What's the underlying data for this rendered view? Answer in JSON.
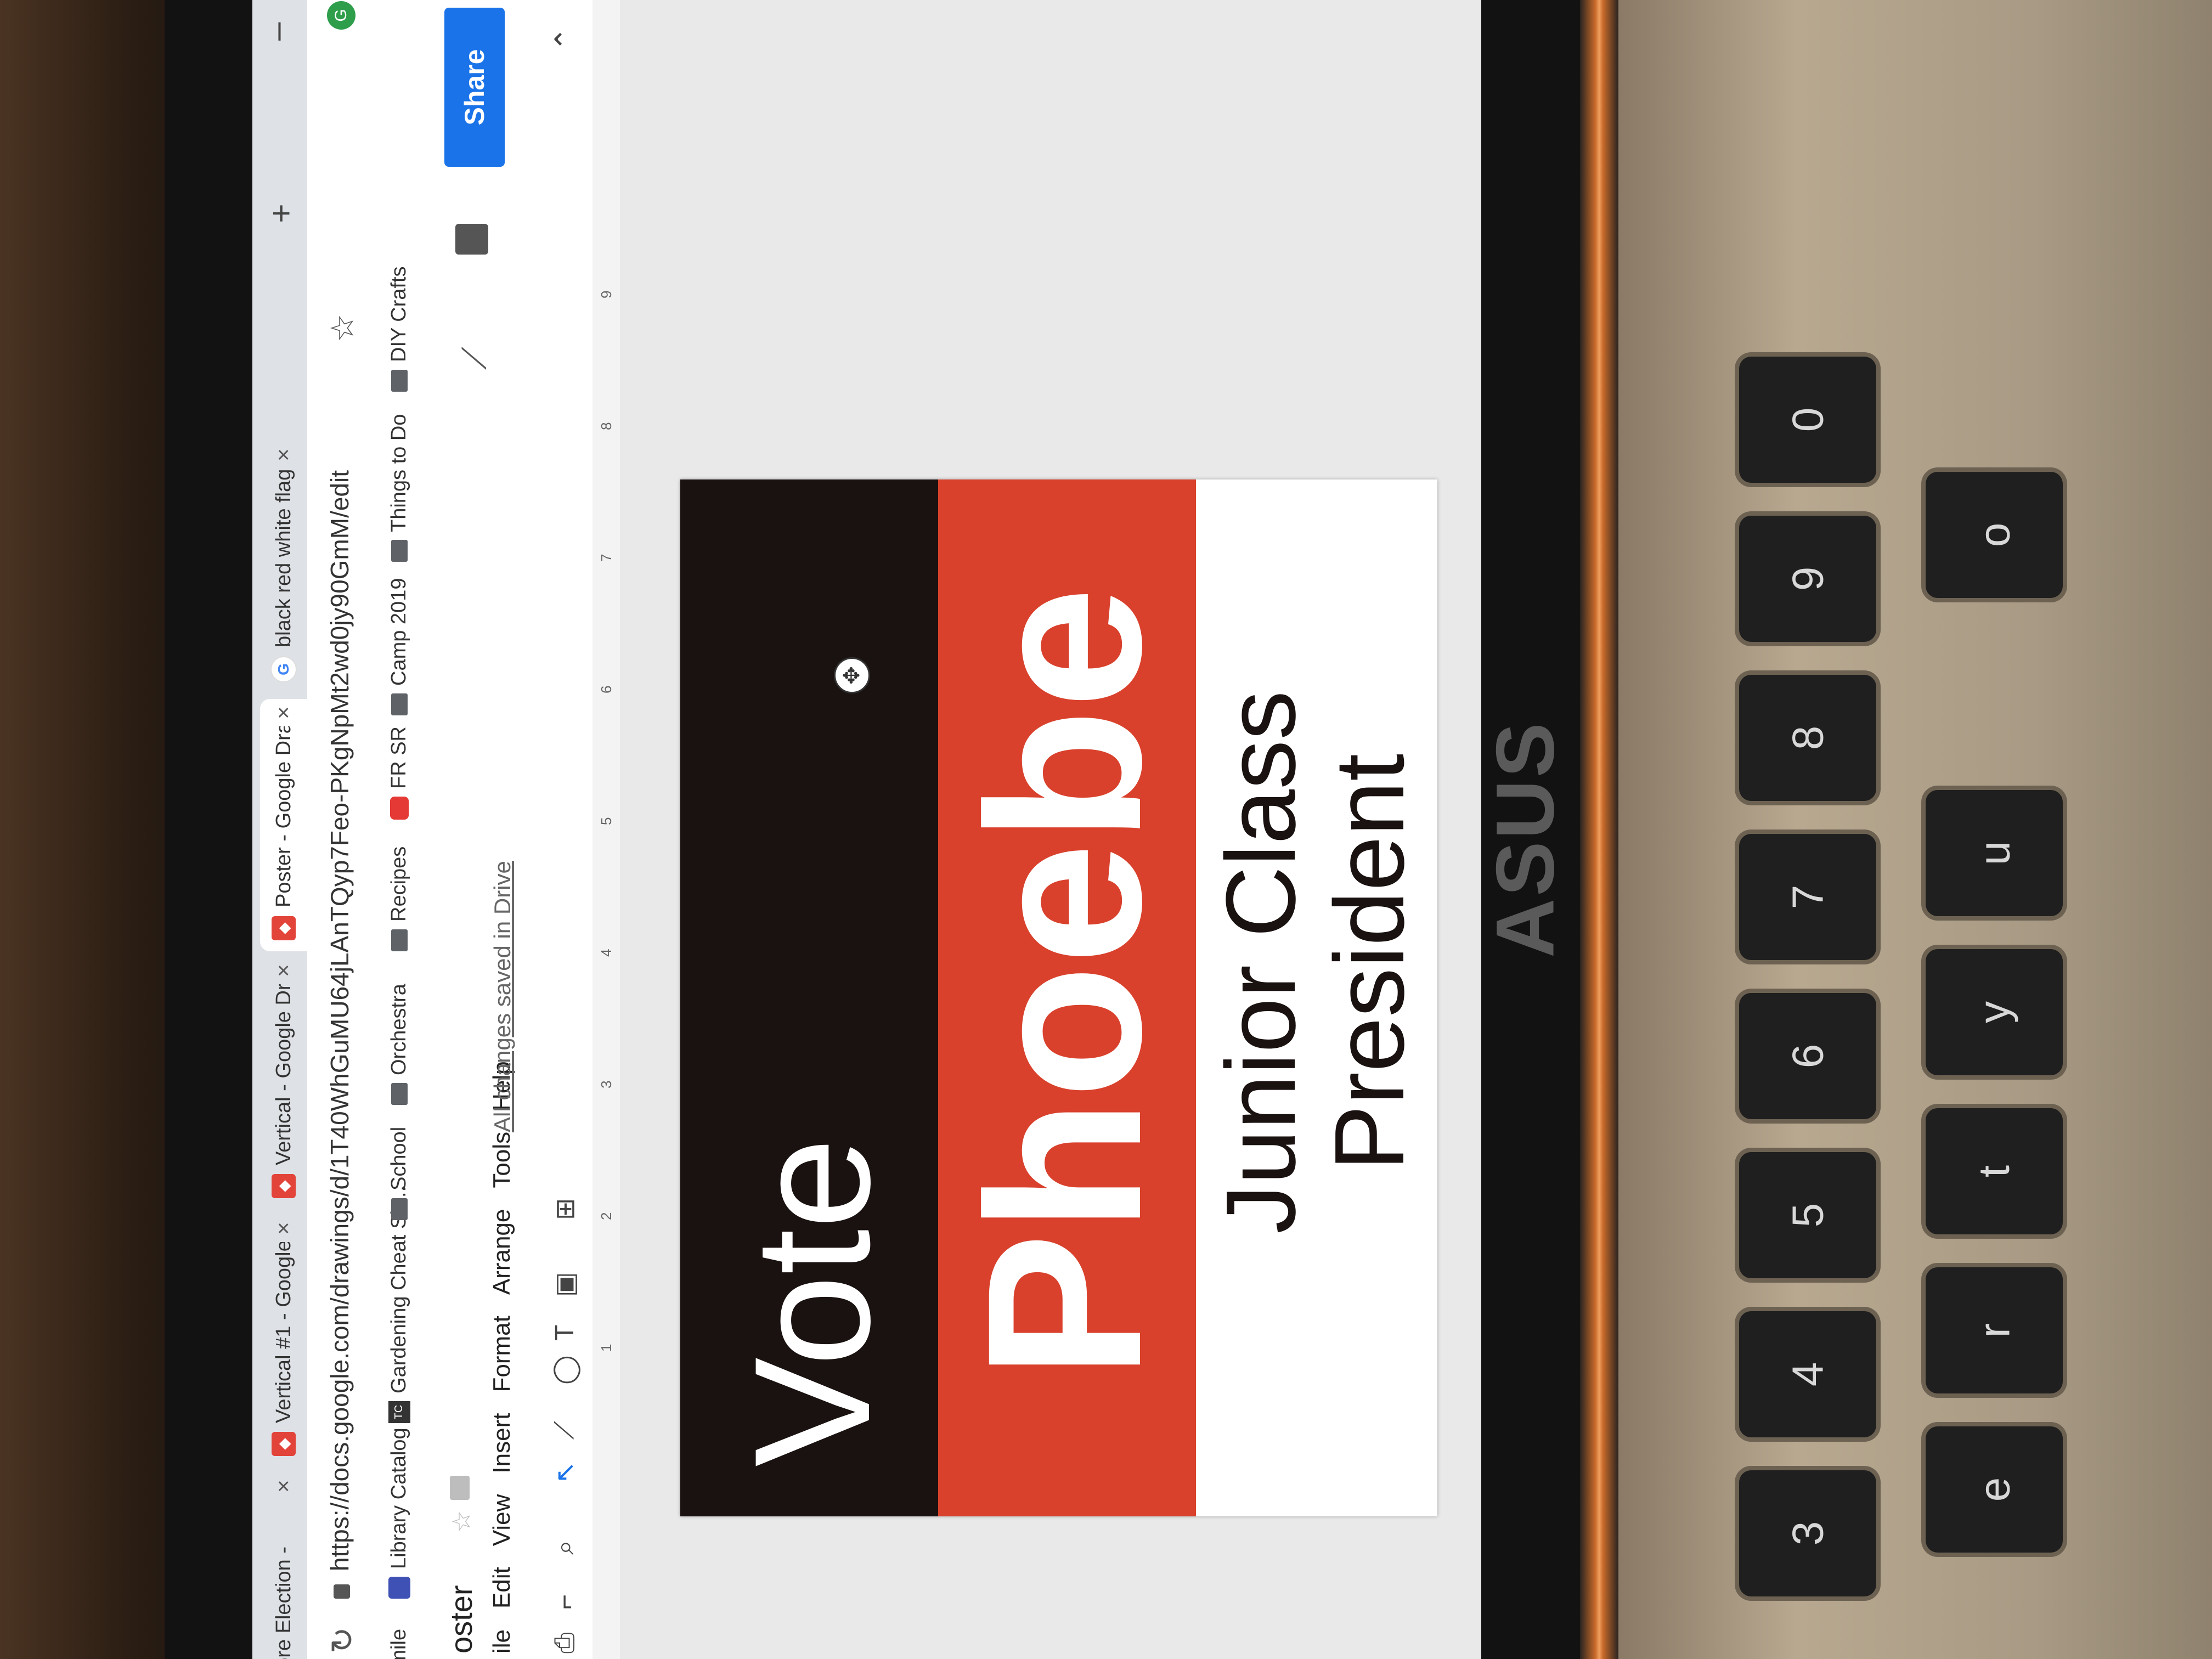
{
  "browser": {
    "tabs": [
      {
        "title": "nore Election -",
        "icon": "google-drawings-icon"
      },
      {
        "title": "Vertical #1 - Google D",
        "icon": "google-drawings-icon"
      },
      {
        "title": "Vertical - Google Draw",
        "icon": "google-drawings-icon"
      },
      {
        "title": "Poster - Google Drawi",
        "icon": "google-drawings-icon"
      },
      {
        "title": "black red white flag - G",
        "icon": "google-search-icon"
      }
    ],
    "close_glyph": "×",
    "new_tab_glyph": "+",
    "minimize_glyph": "–",
    "url": "https://docs.google.com/drawings/d/1T40WhGuMU64jLAnTQyp7Feo-PKgNpMt2wd0jy90GmM/edit",
    "bookmarks": [
      {
        "label": "Smile",
        "icon": "smile-icon"
      },
      {
        "label": "Library Catalog",
        "icon": "library-icon"
      },
      {
        "label": "Gardening Cheat Sh...",
        "icon": "tc-icon"
      },
      {
        "label": "School",
        "icon": "folder-icon"
      },
      {
        "label": "Orchestra",
        "icon": "folder-icon"
      },
      {
        "label": "Recipes",
        "icon": "folder-icon"
      },
      {
        "label": "FR SR",
        "icon": "youtube-icon"
      },
      {
        "label": "Camp 2019",
        "icon": "folder-icon"
      },
      {
        "label": "Things to Do",
        "icon": "folder-icon"
      },
      {
        "label": "DIY Crafts",
        "icon": "folder-icon"
      }
    ]
  },
  "app": {
    "doc_title": "oster",
    "menu": [
      "ile",
      "Edit",
      "View",
      "Insert",
      "Format",
      "Arrange",
      "Tools",
      "Help"
    ],
    "saved_status": "All changes saved in Drive",
    "share_label": "Share",
    "ruler_ticks": [
      "1",
      "2",
      "3",
      "4",
      "5",
      "6",
      "7",
      "8",
      "9"
    ]
  },
  "poster": {
    "line1": "Vote",
    "line2": "Phoebe",
    "line3": "Junior Class",
    "line4": "President",
    "colors": {
      "black_band": "#1a1210",
      "red_band": "#d9412c",
      "text_light": "#ffffff"
    }
  },
  "device": {
    "brand": "ASUS",
    "keys": [
      "#",
      "3",
      "$",
      "4",
      "%",
      "5",
      "^",
      "6",
      "&",
      "7",
      "*",
      "8",
      "(",
      "9",
      ")",
      "0",
      "e",
      "r",
      "t",
      "y",
      "u",
      "o"
    ]
  }
}
